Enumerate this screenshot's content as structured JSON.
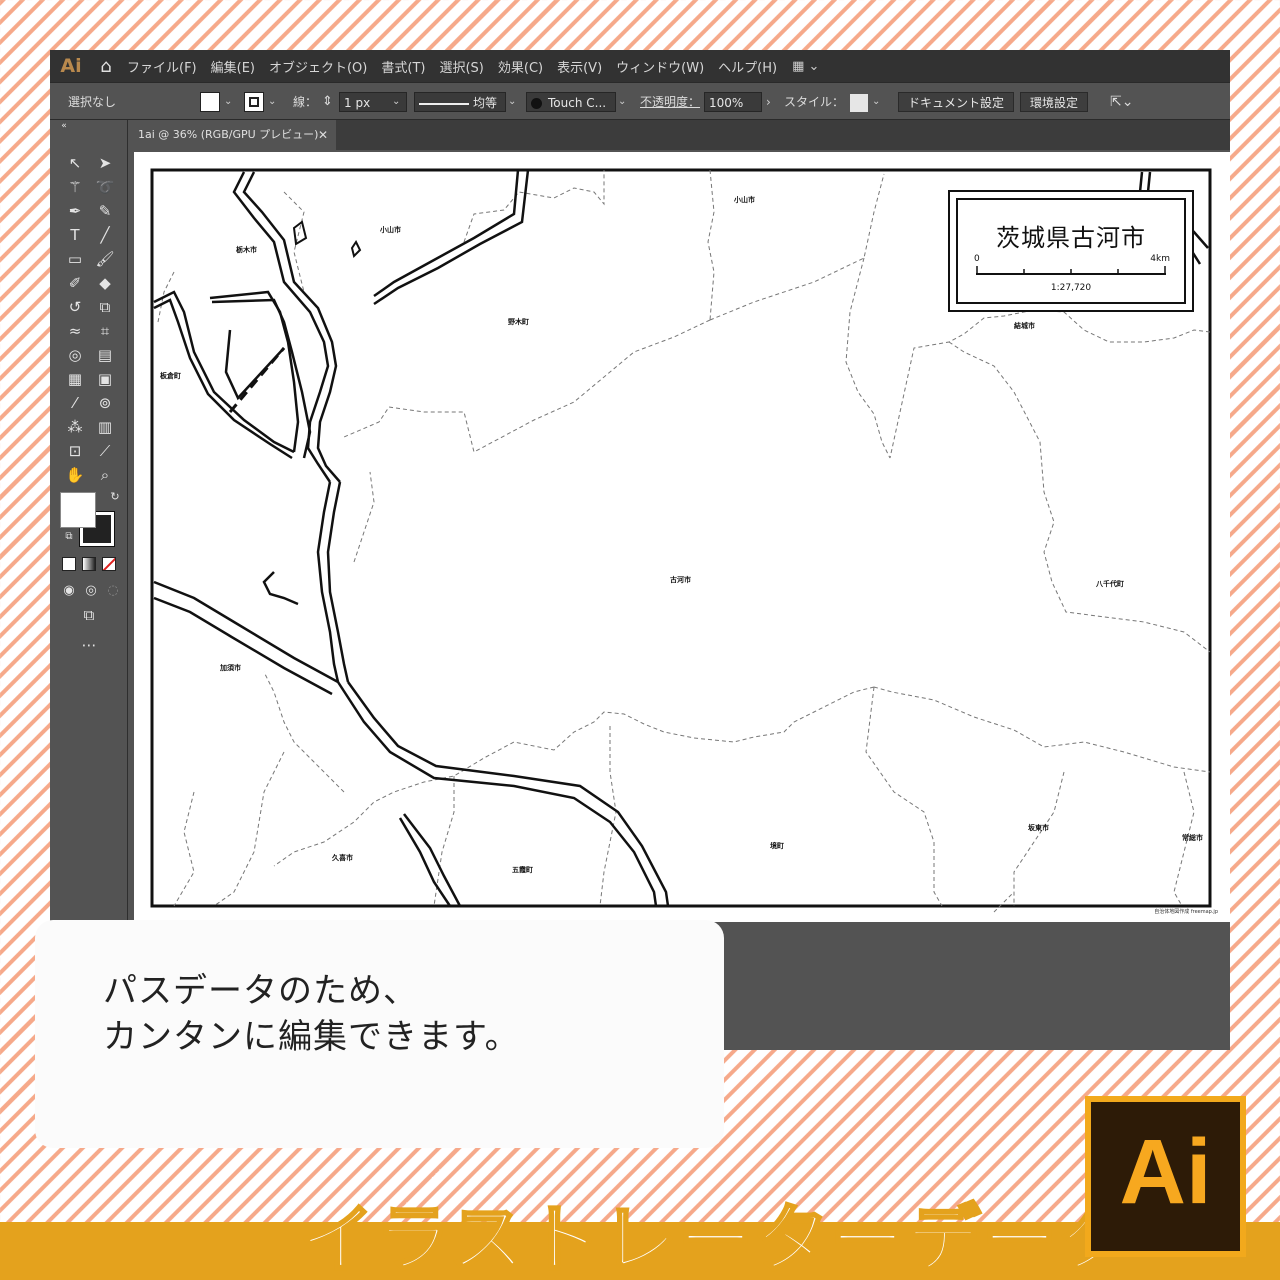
{
  "app": {
    "logo": "Ai",
    "menu": [
      "ファイル(F)",
      "編集(E)",
      "オブジェクト(O)",
      "書式(T)",
      "選択(S)",
      "効果(C)",
      "表示(V)",
      "ウィンドウ(W)",
      "ヘルプ(H)"
    ]
  },
  "controlbar": {
    "selection_status": "選択なし",
    "stroke_label": "線：",
    "stroke_weight": "1 px",
    "stroke_profile": "均等",
    "brush": "Touch C...",
    "opacity_label": "不透明度：",
    "opacity_value": "100%",
    "style_label": "スタイル：",
    "doc_setup_button": "ドキュメント設定",
    "prefs_button": "環境設定"
  },
  "document": {
    "tab_title": "1ai @ 36% (RGB/GPU プレビュー)"
  },
  "map": {
    "title": "茨城県古河市",
    "scale_start": "0",
    "scale_end": "4km",
    "scale_ratio": "1:27,720",
    "credit": "自治体地図作成 freemap.jp",
    "labels": [
      {
        "id": "oyama-1",
        "text": "小山市"
      },
      {
        "id": "oyama-2",
        "text": "小山市"
      },
      {
        "id": "tochigi",
        "text": "栃木市"
      },
      {
        "id": "nogi",
        "text": "野木町"
      },
      {
        "id": "yuki",
        "text": "結城市"
      },
      {
        "id": "itakura",
        "text": "板倉町"
      },
      {
        "id": "koga",
        "text": "古河市"
      },
      {
        "id": "yachiyo",
        "text": "八千代町"
      },
      {
        "id": "kazo",
        "text": "加須市"
      },
      {
        "id": "kuki",
        "text": "久喜市"
      },
      {
        "id": "goka",
        "text": "五霞町"
      },
      {
        "id": "sakai",
        "text": "境町"
      },
      {
        "id": "bando",
        "text": "坂東市"
      },
      {
        "id": "joso",
        "text": "常総市"
      }
    ]
  },
  "callout": {
    "text": "パスデータのため、\nカンタンに編集できます。"
  },
  "banner": {
    "title": "イラストレーターデータ",
    "badge": "Ai"
  },
  "colors": {
    "stripe": "#f6a98a",
    "band": "#e4a21d",
    "badge_bg": "#2d1b07",
    "badge_fg": "#f7a81f"
  }
}
